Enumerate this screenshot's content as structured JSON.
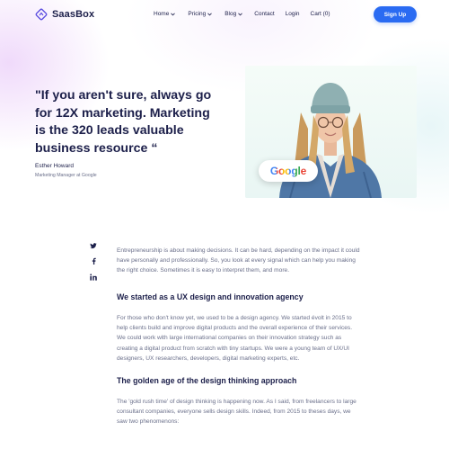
{
  "nav": {
    "brand": "SaasBox",
    "links": [
      {
        "label": "Home",
        "dropdown": true
      },
      {
        "label": "Pricing",
        "dropdown": true
      },
      {
        "label": "Blog",
        "dropdown": true
      },
      {
        "label": "Contact",
        "dropdown": false
      },
      {
        "label": "Login",
        "dropdown": false
      },
      {
        "label": "Cart (0)",
        "dropdown": false
      }
    ],
    "signup_label": "Sign Up"
  },
  "hero": {
    "quote": "\"If you aren't sure, always go for 12X marketing. Marketing is the 320 leads valuable business resource “",
    "author_name": "Esther Howard",
    "author_role": "Marketing Manager at Google",
    "badge_text": "Google"
  },
  "social": {
    "icons": [
      "twitter-icon",
      "facebook-icon",
      "linkedin-icon"
    ]
  },
  "article": {
    "intro": "Entrepreneurship is about making decisions. It can be hard, depending on the impact it could have personally and professionally. So, you look at every signal which can help you making the right choice. Sometimes it is easy to interpret them, and more.",
    "section1_title": "We started as a UX design and innovation agency",
    "section1_body": "For those who don't know yet, we used to be a design agency. We started évolt in 2015 to help clients build and improve digital products and the overall experience of their services. We could work with large international companies on their innovation strategy such as creating a digital product from scratch with tiny startups. We were a young team of UX/UI designers, UX researchers, developers, digital marketing experts, etc.",
    "section2_title": "The golden age of the design thinking approach",
    "section2_body": "The 'gold rush time' of design thinking is happening now. As I said, from freelancers to large consultant companies, everyone sells design skills. Indeed, from 2015 to theses days, we saw two phenomenons:"
  },
  "colors": {
    "primary": "#2a6bf2",
    "heading": "#1c1f4a",
    "body_text": "#6a6f8a"
  }
}
